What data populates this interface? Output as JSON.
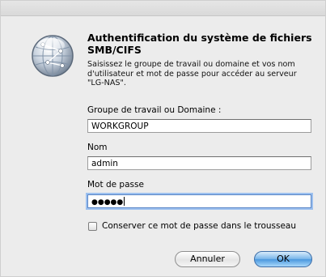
{
  "dialog": {
    "title_line1": "Authentification du système de fichiers",
    "title_line2": "SMB/CIFS",
    "description_line1": "Saisissez le groupe de travail ou domaine et vos nom",
    "description_line2": "d'utilisateur et mot de passe pour accéder au serveur",
    "description_line3": "\"LG-NAS\".",
    "icon": "network-globe-icon"
  },
  "workgroup": {
    "label": "Groupe de travail ou Domaine :",
    "value": "WORKGROUP"
  },
  "name": {
    "label": "Nom",
    "value": "admin"
  },
  "password": {
    "label": "Mot de passe",
    "masked_value": "●●●●●"
  },
  "keychain": {
    "label": "Conserver ce mot de passe dans le trousseau",
    "checked": false
  },
  "buttons": {
    "cancel": "Annuler",
    "ok": "OK"
  },
  "colors": {
    "default_button": "#4b98de",
    "focus_ring": "#9cc0ef"
  }
}
